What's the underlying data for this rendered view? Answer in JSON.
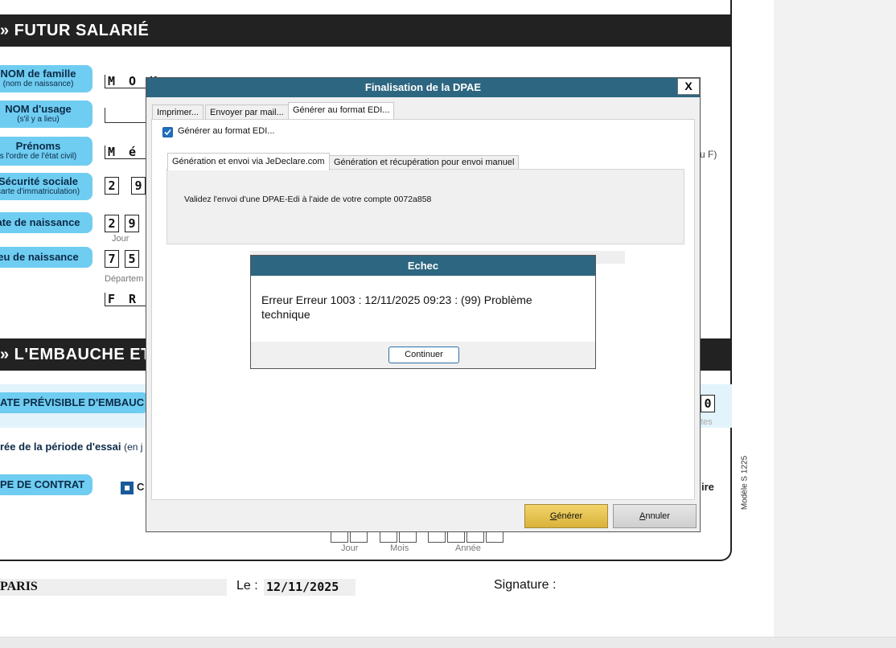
{
  "document": {
    "section1_title": "» FUTUR SALARIÉ",
    "section2_title": "» L'EMBAUCHE ET L",
    "fields": {
      "nom_famille": {
        "label": "NOM de famille",
        "sub": "(nom de naissance)",
        "value": "M O K"
      },
      "nom_usage": {
        "label": "NOM d'usage",
        "sub": "(s'il y a lieu)"
      },
      "prenoms": {
        "label": "Prénoms",
        "sub": "s l'ordre de l'état civil)",
        "value": "M é L"
      },
      "securite_sociale": {
        "label": "Sécurité sociale",
        "sub": "carte d'immatriculation)",
        "d1": "2",
        "d2": "9"
      },
      "date_naissance": {
        "label": "ate de naissance",
        "d1": "2",
        "d2": "9",
        "unit": "Jour"
      },
      "lieu_naissance": {
        "label": "eu de naissance",
        "d1": "7",
        "d2": "5",
        "unit": "Départem",
        "country": "F R A"
      },
      "date_embauche": {
        "label": "ATE PRÉVISIBLE D'EMBAUC",
        "right_digit": "0",
        "right_sub": "tes"
      },
      "periode_essai": {
        "label": "rée de la période d'essai",
        "sub": "(en j"
      },
      "type_contrat": {
        "label": "PE DE CONTRAT",
        "check_label": "C",
        "right_label": "ire"
      }
    },
    "side_note": "u F)",
    "date_labels": {
      "jour": "Jour",
      "mois": "Mois",
      "annee": "Année"
    },
    "footer": {
      "city": "PARIS",
      "le_label": "Le :",
      "date": "12/11/2025",
      "signature_label": "Signature :"
    },
    "vertical_text": "Modèle S 1225"
  },
  "dpae_dialog": {
    "title": "Finalisation de la DPAE",
    "close_label": "X",
    "tabs": [
      "Imprimer...",
      "Envoyer par mail...",
      "Générer au format EDI..."
    ],
    "checkbox_label": "Générer au format EDI...",
    "subtabs": [
      "Génération et envoi via JeDeclare.com",
      "Génération et récupération pour envoi manuel"
    ],
    "message": "Validez l'envoi d'une DPAE-Edi à l'aide de votre compte 0072a858",
    "generer_label": "Générer",
    "annuler_label": "Annuler"
  },
  "echec_dialog": {
    "title": "Echec",
    "message": "Erreur Erreur 1003 : 12/11/2025 09:23 : (99) Problème technique",
    "continuer_label": "Continuer"
  }
}
